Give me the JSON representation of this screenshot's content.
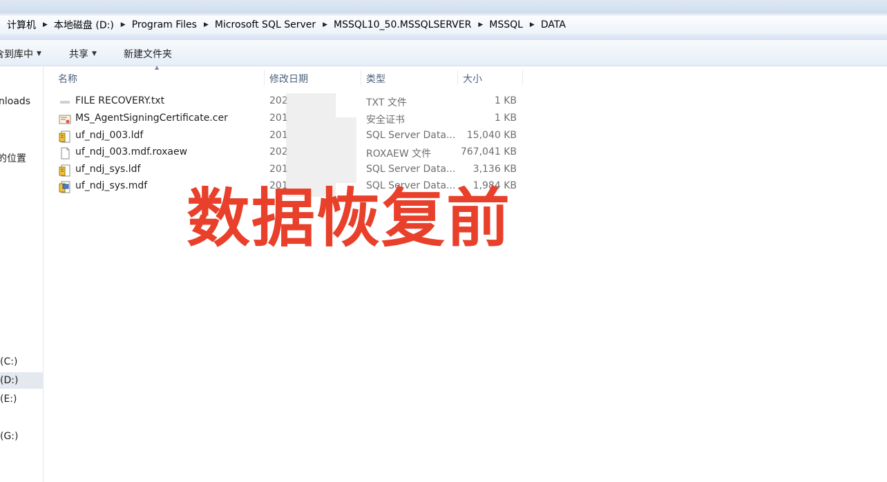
{
  "breadcrumb": [
    "计算机",
    "本地磁盘 (D:)",
    "Program Files",
    "Microsoft SQL Server",
    "MSSQL10_50.MSSQLSERVER",
    "MSSQL",
    "DATA"
  ],
  "toolbar": {
    "include_library": "含到库中",
    "share": "共享",
    "new_folder": "新建文件夹"
  },
  "nav": {
    "downloads": "nloads",
    "recent_places": "的位置",
    "drive_c": "(C:)",
    "drive_d": "(D:)",
    "drive_e": "(E:)",
    "drive_g": "(G:)"
  },
  "columns": {
    "name": "名称",
    "date": "修改日期",
    "type": "类型",
    "size": "大小"
  },
  "files": [
    {
      "name": "FILE RECOVERY.txt",
      "date": "202",
      "type": "TXT 文件",
      "size": "1 KB",
      "icon": "text-file-icon"
    },
    {
      "name": "MS_AgentSigningCertificate.cer",
      "date": "201",
      "type": "安全证书",
      "size": "1 KB",
      "icon": "certificate-icon"
    },
    {
      "name": "uf_ndj_003.ldf",
      "date": "201",
      "type": "SQL Server Data...",
      "size": "15,040 KB",
      "icon": "sql-log-file-icon"
    },
    {
      "name": "uf_ndj_003.mdf.roxaew",
      "date": "202",
      "type": "ROXAEW 文件",
      "size": "767,041 KB",
      "icon": "blank-file-icon"
    },
    {
      "name": "uf_ndj_sys.ldf",
      "date": "201",
      "type": "SQL Server Data...",
      "size": "3,136 KB",
      "icon": "sql-log-file-icon"
    },
    {
      "name": "uf_ndj_sys.mdf",
      "date": "201",
      "type": "SQL Server Data...",
      "size": "1,984 KB",
      "icon": "sql-data-file-icon"
    }
  ],
  "overlay_caption": "数据恢复前",
  "colors": {
    "caption": "#e8402a",
    "header_text": "#4c607a",
    "secondary_text": "#6d6d6d"
  }
}
